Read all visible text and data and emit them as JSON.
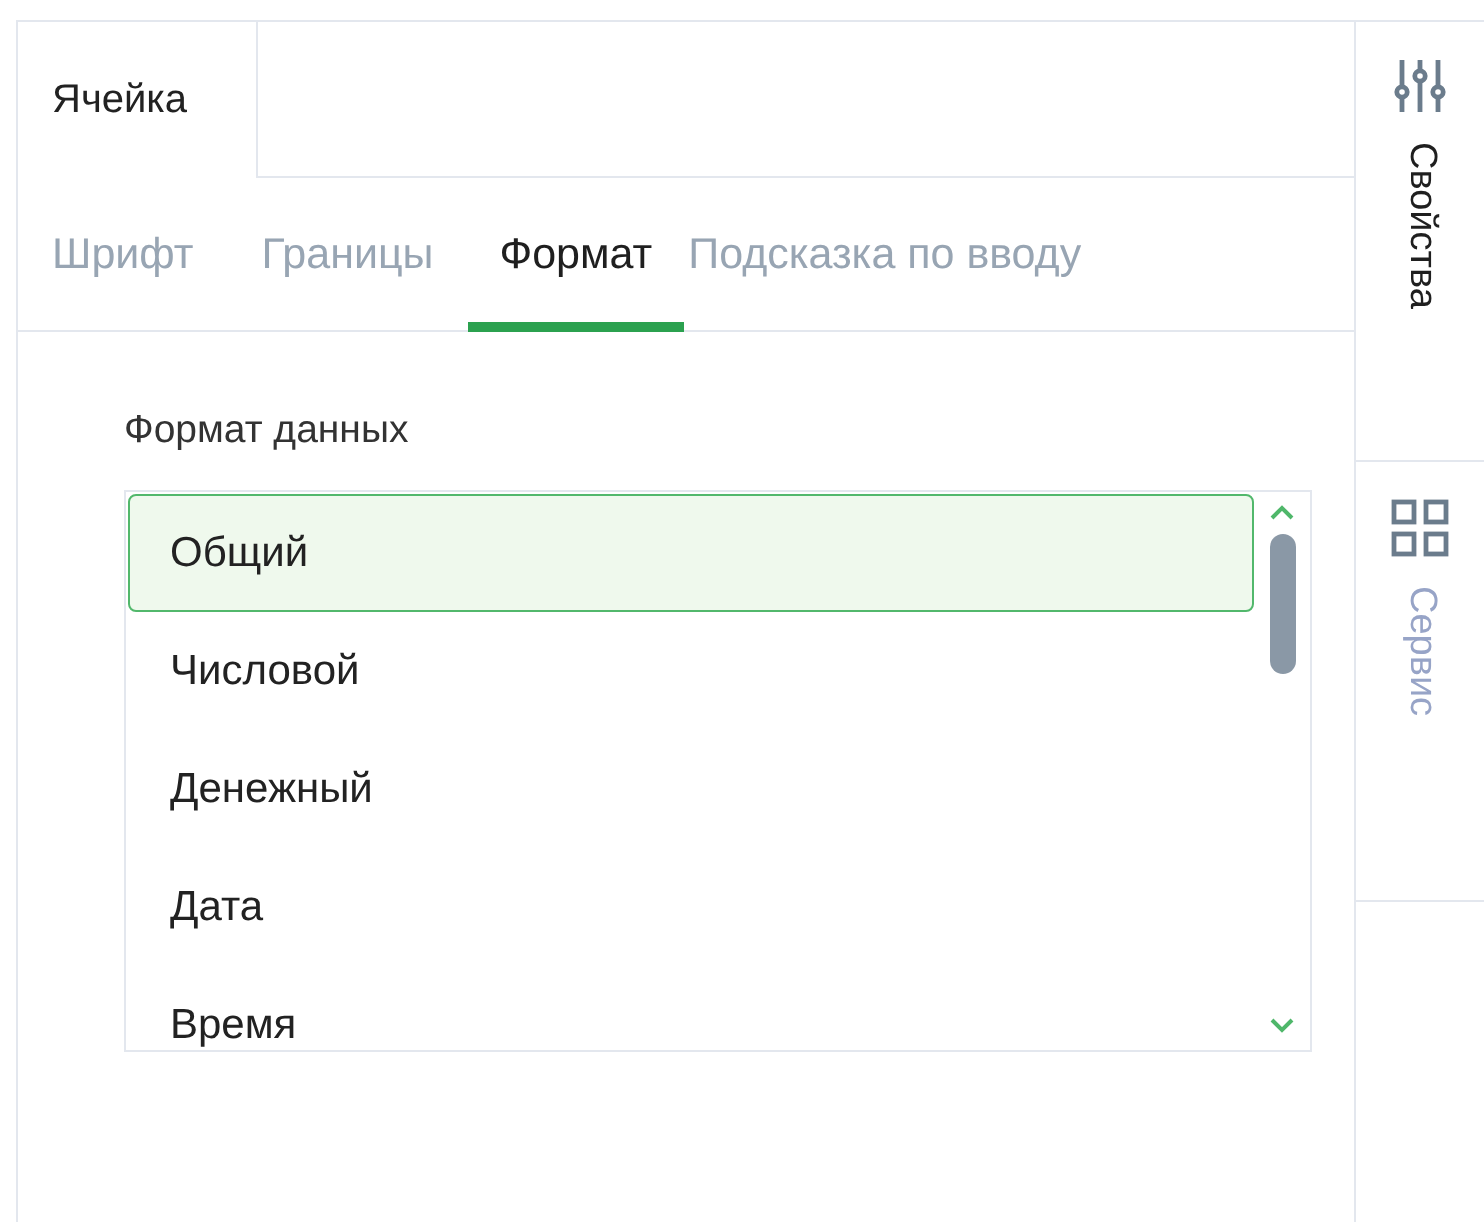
{
  "panel_tabs": [
    {
      "label": "Ячейка",
      "selected": true
    }
  ],
  "subtabs": [
    {
      "label": "Шрифт",
      "selected": false
    },
    {
      "label": "Границы",
      "selected": false
    },
    {
      "label": "Формат",
      "selected": true
    },
    {
      "label": "Подсказка по вводу",
      "selected": false
    }
  ],
  "data_format": {
    "label": "Формат данных",
    "options": [
      {
        "label": "Общий",
        "selected": true
      },
      {
        "label": "Числовой",
        "selected": false
      },
      {
        "label": "Денежный",
        "selected": false
      },
      {
        "label": "Дата",
        "selected": false
      },
      {
        "label": "Время",
        "selected": false
      }
    ]
  },
  "side_tabs": [
    {
      "label": "Свойства",
      "selected": true
    },
    {
      "label": "Сервис",
      "selected": false
    }
  ]
}
